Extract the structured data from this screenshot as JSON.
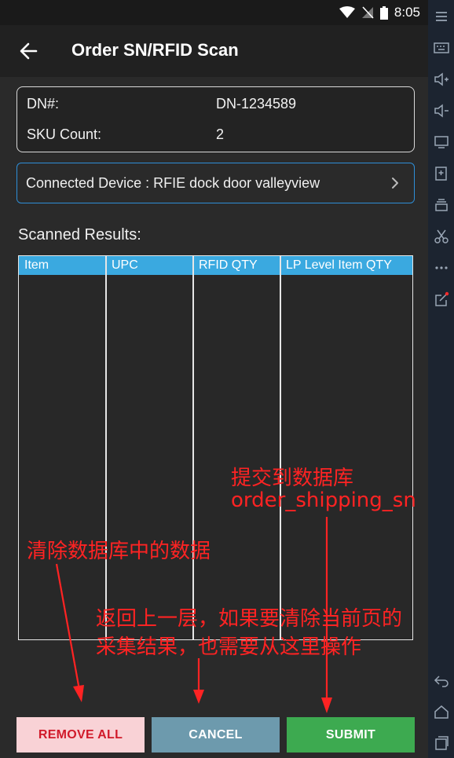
{
  "status_bar": {
    "time": "8:05"
  },
  "app_bar": {
    "title": "Order SN/RFID Scan"
  },
  "order_info": {
    "dn_label": "DN#:",
    "dn_value": "DN-1234589",
    "sku_label": "SKU Count:",
    "sku_value": "2"
  },
  "device": {
    "text": "Connected Device : RFIE dock door valleyview"
  },
  "results": {
    "title": "Scanned Results:",
    "columns": [
      "Item",
      "UPC",
      "RFID QTY",
      "LP Level Item QTY"
    ],
    "rows": []
  },
  "annotations": {
    "submit_note_line1": "提交到数据库",
    "submit_note_line2": "order_shipping_sn",
    "remove_note": "清除数据库中的数据",
    "cancel_note_line1": "返回上一层，如果要清除当前页的",
    "cancel_note_line2": "采集结果，也需要从这里操作"
  },
  "buttons": {
    "remove_all": "REMOVE ALL",
    "cancel": "CANCEL",
    "submit": "SUBMIT"
  },
  "colors": {
    "table_header": "#3aa9e0",
    "device_border": "#2e8fd8",
    "annotation": "#ff2323",
    "submit": "#3daa50",
    "cancel": "#6d9aad",
    "remove_bg": "#f9d2d6",
    "remove_text": "#d11a2a"
  }
}
